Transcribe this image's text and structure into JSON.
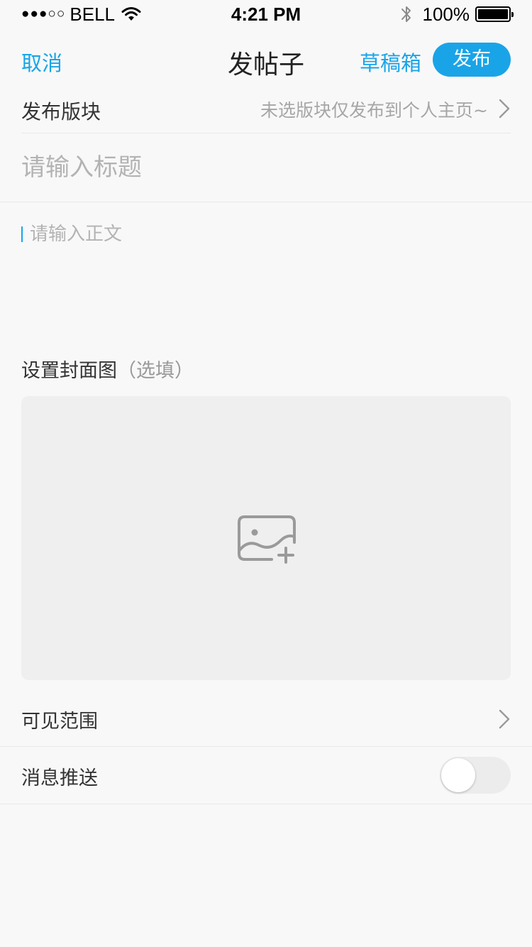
{
  "status_bar": {
    "signal_dots": "●●●○○",
    "carrier": "BELL",
    "wifi_icon": "wifi-icon",
    "time": "4:21 PM",
    "bluetooth_icon": "bluetooth-icon",
    "battery": "100%",
    "battery_level": 1.0
  },
  "nav": {
    "cancel": "取消",
    "title": "发帖子",
    "drafts": "草稿箱",
    "publish": "发布",
    "accent_color": "#1aa4e8"
  },
  "section": {
    "label": "发布版块",
    "value": "未选版块仅发布到个人主页~",
    "chevron_icon": "chevron-right-icon"
  },
  "title_field": {
    "placeholder": "请输入标题",
    "value": ""
  },
  "body_field": {
    "placeholder": "请输入正文",
    "value": ""
  },
  "cover": {
    "label": "设置封面图",
    "optional": "（选填）",
    "icon": "add-image-icon"
  },
  "visibility": {
    "label": "可见范围",
    "chevron_icon": "chevron-right-icon"
  },
  "push": {
    "label": "消息推送",
    "enabled": false
  }
}
